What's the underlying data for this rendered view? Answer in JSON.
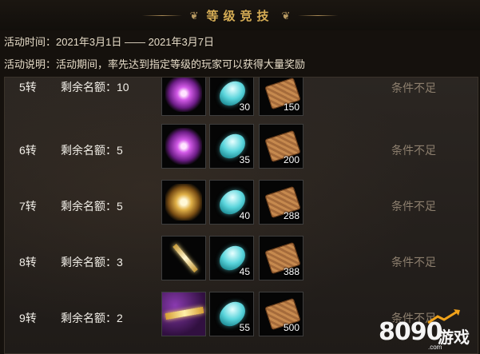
{
  "header": {
    "title": "等级竞技"
  },
  "event": {
    "time_label": "活动时间：2021年3月1日 —— 2021年3月7日",
    "desc_label": "活动说明：活动期间，率先达到指定等级的玩家可以获得大量奖励"
  },
  "rows": [
    {
      "level": "5转",
      "quota": "剩余名额：10",
      "status": "条件不足",
      "reward1_icon": "purple-ring-icon",
      "gem_qty": "30",
      "scroll_qty": "150"
    },
    {
      "level": "6转",
      "quota": "剩余名额：5",
      "status": "条件不足",
      "reward1_icon": "purple-ring-icon",
      "gem_qty": "35",
      "scroll_qty": "200"
    },
    {
      "level": "7转",
      "quota": "剩余名额：5",
      "status": "条件不足",
      "reward1_icon": "gold-ornament-icon",
      "gem_qty": "40",
      "scroll_qty": "288"
    },
    {
      "level": "8转",
      "quota": "剩余名额：3",
      "status": "条件不足",
      "reward1_icon": "gold-sword-icon",
      "gem_qty": "45",
      "scroll_qty": "388"
    },
    {
      "level": "9转",
      "quota": "剩余名额：2",
      "status": "条件不足",
      "reward1_icon": "gold-bar-icon",
      "gem_qty": "55",
      "scroll_qty": "500"
    }
  ],
  "watermark": {
    "number": "8090",
    "text": "游戏",
    "domain": ".com"
  }
}
